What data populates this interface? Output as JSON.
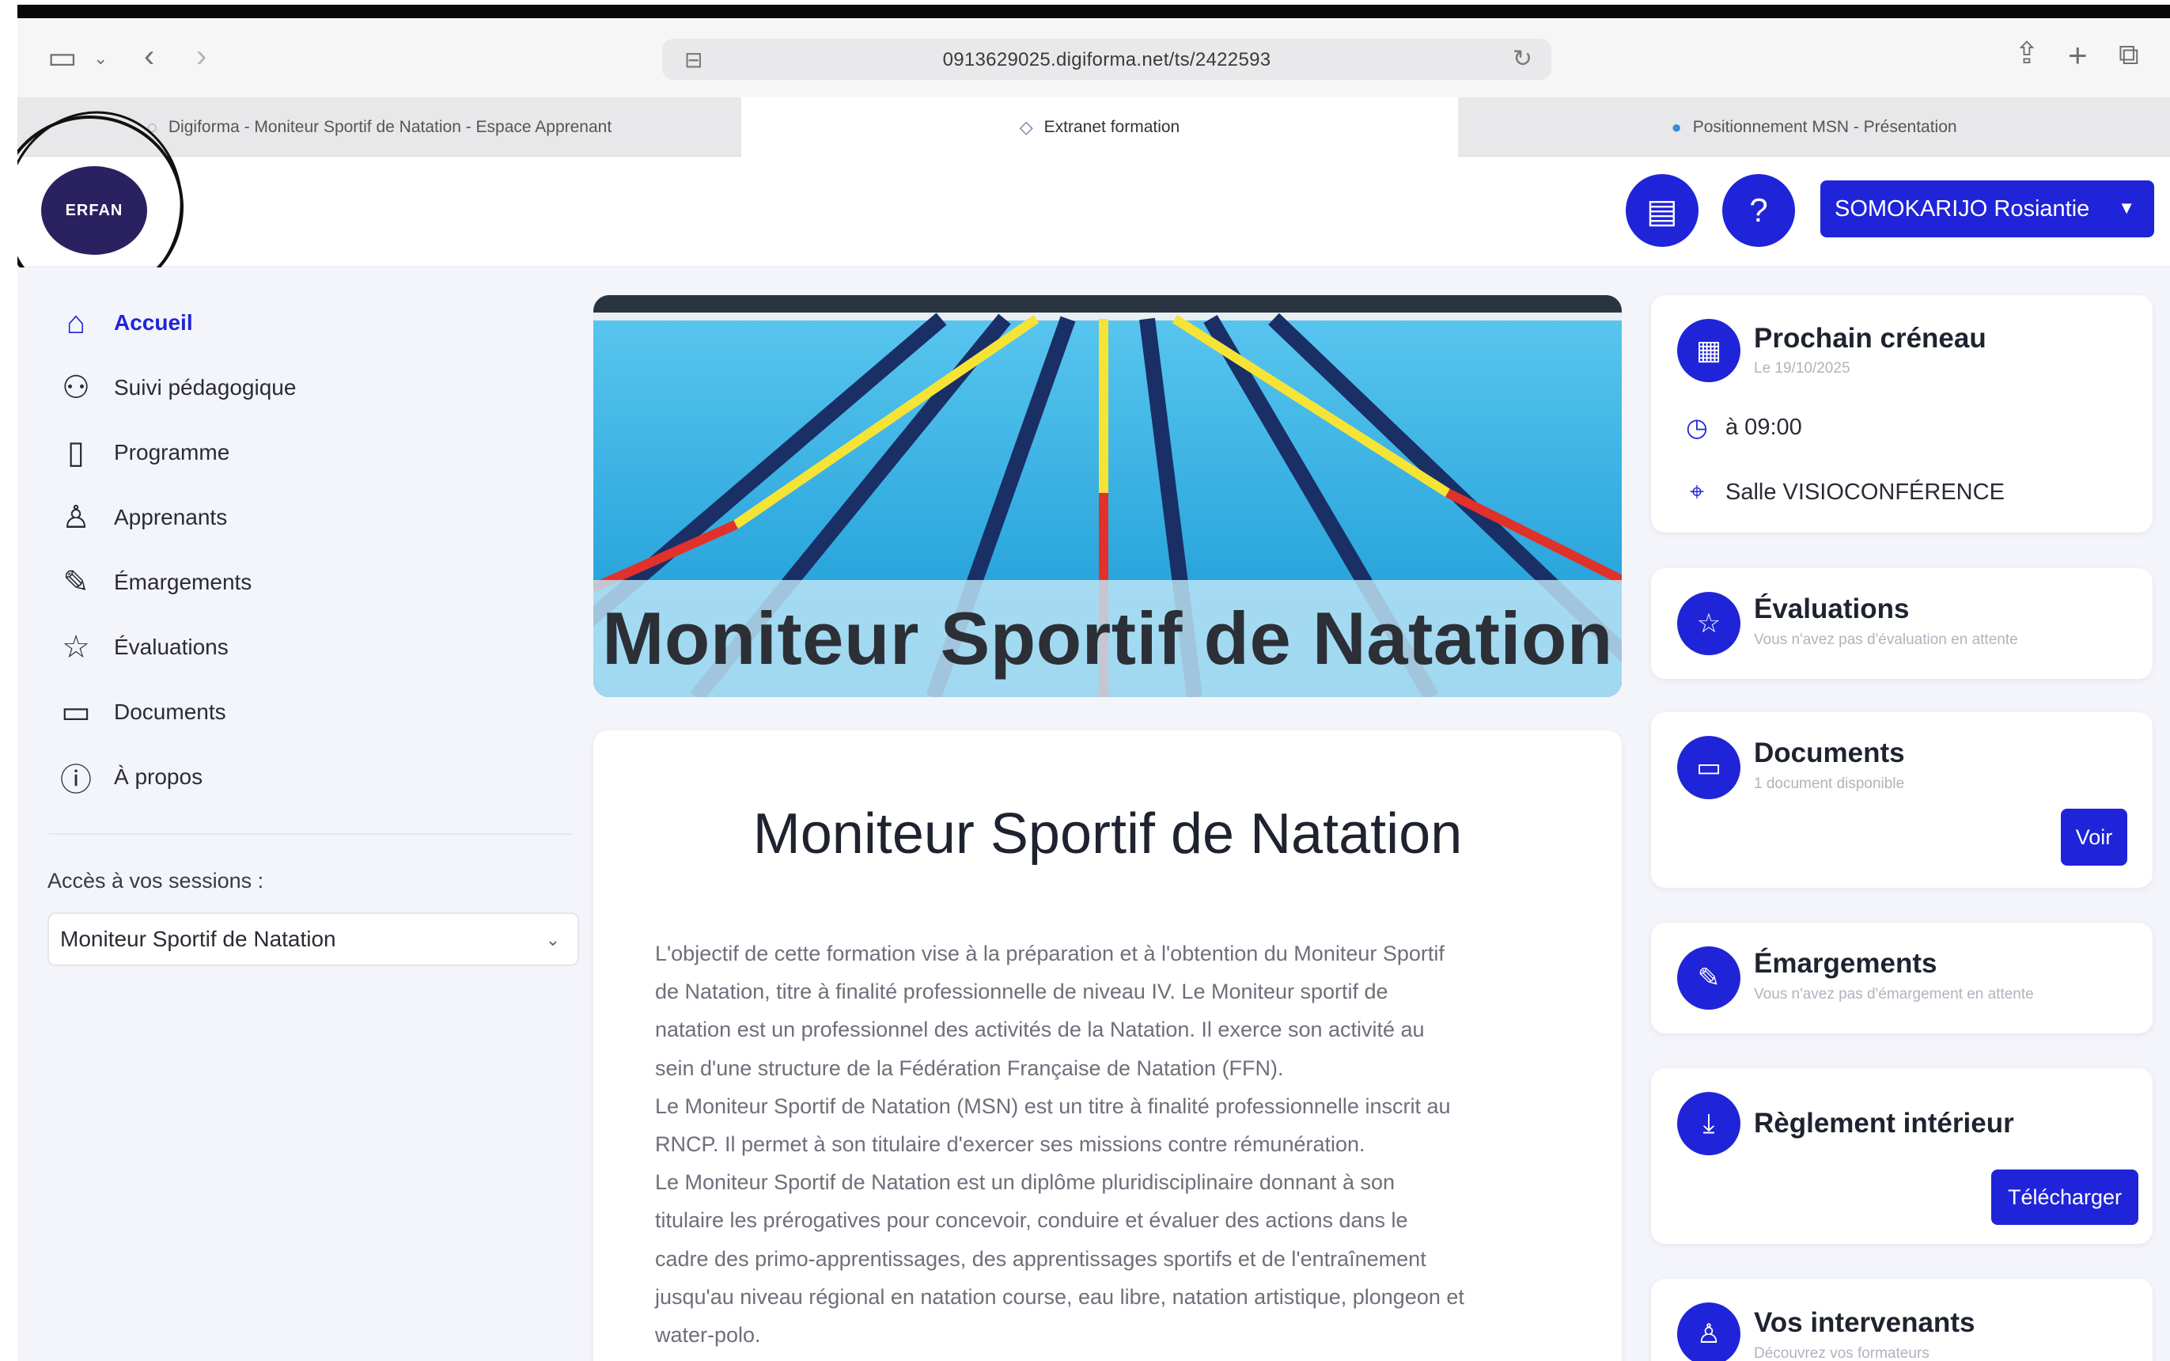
{
  "browser": {
    "url": "0913629025.digiforma.net/ts/2422593",
    "tabs": [
      {
        "label": "Digiforma - Moniteur Sportif de Natation - Espace Apprenant"
      },
      {
        "label": "Extranet formation"
      },
      {
        "label": "Positionnement MSN - Présentation"
      }
    ]
  },
  "header": {
    "logo_text": "ERFAN",
    "user_name": "SOMOKARIJO Rosiantie"
  },
  "sidebar": {
    "items": [
      {
        "label": "Accueil",
        "icon": "home-icon"
      },
      {
        "label": "Suivi pédagogique",
        "icon": "users-icon"
      },
      {
        "label": "Programme",
        "icon": "clipboard-icon"
      },
      {
        "label": "Apprenants",
        "icon": "learner-icon"
      },
      {
        "label": "Émargements",
        "icon": "pen-icon"
      },
      {
        "label": "Évaluations",
        "icon": "star-icon"
      },
      {
        "label": "Documents",
        "icon": "folder-icon"
      },
      {
        "label": "À propos",
        "icon": "info-icon"
      }
    ],
    "sessions_label": "Accès à vos sessions :",
    "session_selected": "Moniteur Sportif de Natation"
  },
  "main": {
    "banner_title": "Moniteur Sportif de Natation",
    "card_title": "Moniteur Sportif de Natation",
    "description": [
      "L'objectif de cette formation vise à la préparation et à l'obtention du Moniteur Sportif",
      "de Natation, titre à finalité professionnelle de niveau IV. Le Moniteur sportif de",
      "natation est un professionnel des activités de la Natation. Il exerce son activité au",
      "sein d'une structure de la Fédération Française de Natation (FFN).",
      "Le Moniteur Sportif de Natation (MSN) est un titre à finalité professionnelle inscrit au",
      "RNCP. Il permet à son titulaire d'exercer ses missions contre rémunération.",
      "Le Moniteur Sportif de Natation est un diplôme pluridisciplinaire donnant à son",
      "titulaire les prérogatives pour concevoir, conduire et évaluer des actions dans le",
      "cadre des primo-apprentissages, des apprentissages sportifs et de l'entraînement",
      "jusqu'au niveau régional en natation course, eau libre, natation artistique, plongeon et",
      "water-polo."
    ]
  },
  "right": {
    "prochain": {
      "title": "Prochain créneau",
      "date": "Le 19/10/2025",
      "time": "à 09:00",
      "room": "Salle VISIOCONFÉRENCE"
    },
    "evaluations": {
      "title": "Évaluations",
      "sub": "Vous n'avez pas d'évaluation en attente"
    },
    "documents": {
      "title": "Documents",
      "sub": "1 document disponible",
      "button": "Voir"
    },
    "emargements": {
      "title": "Émargements",
      "sub": "Vous n'avez pas d'émargement en attente"
    },
    "reglement": {
      "title": "Règlement intérieur",
      "button": "Télécharger"
    },
    "intervenants": {
      "title": "Vos intervenants",
      "sub": "Découvrez vos formateurs"
    }
  },
  "colors": {
    "accent": "#2024d8",
    "background": "#f4f5fa",
    "pool": "#1fa7e0"
  }
}
